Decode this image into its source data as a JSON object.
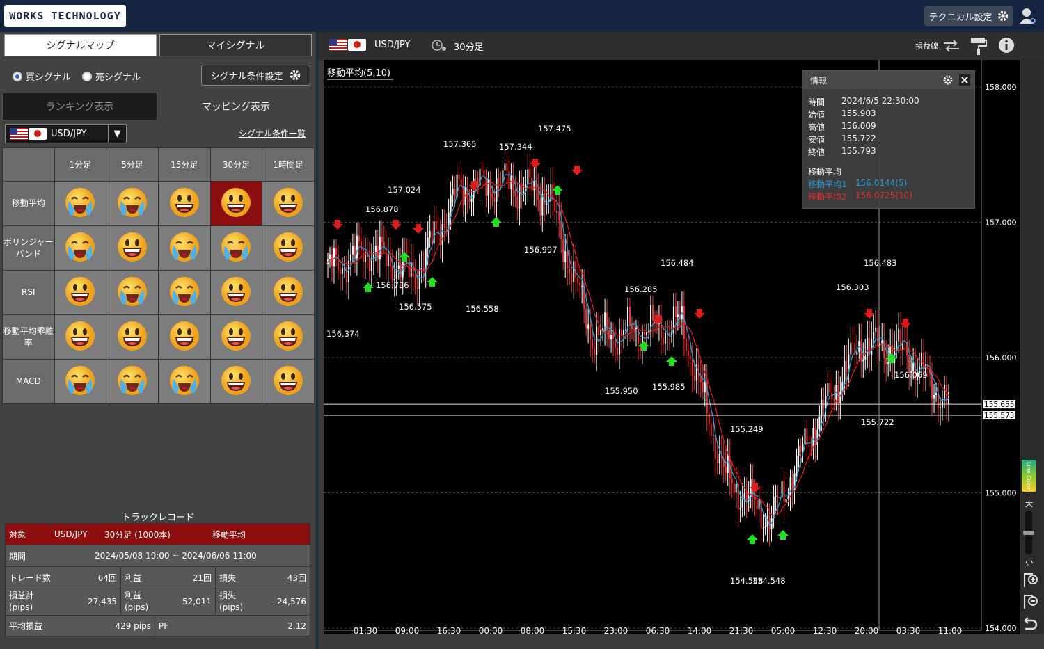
{
  "app": {
    "logo": "WORKS TECHNOLOGY",
    "tech_settings": "テクニカル設定"
  },
  "left": {
    "tabs": [
      "シグナルマップ",
      "マイシグナル"
    ],
    "radio_buy": "買シグナル",
    "radio_sell": "売シグナル",
    "cond_btn": "シグナル条件設定",
    "view_tabs": [
      "ランキング表示",
      "マッピング表示"
    ],
    "pair": "USD/JPY",
    "cond_list": "シグナル条件一覧",
    "timeframes": [
      "1分足",
      "5分足",
      "15分足",
      "30分足",
      "1時間足"
    ],
    "rows": [
      {
        "label": "移動平均",
        "cells": [
          "cry",
          "cry",
          "smile",
          "smile-sel",
          "smile"
        ]
      },
      {
        "label": "ボリンジャー バンド",
        "cells": [
          "cry",
          "smile",
          "cry",
          "cry",
          "smile"
        ]
      },
      {
        "label": "RSI",
        "cells": [
          "smile",
          "cry",
          "cry",
          "smile",
          "smile"
        ]
      },
      {
        "label": "移動平均乖離率",
        "cells": [
          "smile",
          "smile",
          "smile",
          "smile",
          "smile"
        ]
      },
      {
        "label": "MACD",
        "cells": [
          "cry",
          "cry",
          "cry",
          "smile",
          "smile"
        ]
      }
    ],
    "track": {
      "title": "トラックレコード",
      "target_k": "対象",
      "target_pair": "USD/JPY",
      "target_tf": "30分足 (1000本)",
      "target_ind": "移動平均",
      "period_k": "期間",
      "period_v": "2024/05/08 19:00 ~ 2024/06/06 11:00",
      "trades_k": "トレード数",
      "trades_v": "64回",
      "win_k": "利益",
      "win_v": "21回",
      "loss_k": "損失",
      "loss_v": "43回",
      "pl_k": "損益計\n(pips)",
      "pl_v": "27,435",
      "profit_k": "利益\n(pips)",
      "profit_v": "52,011",
      "lossp_k": "損失\n(pips)",
      "lossp_v": "- 24,576",
      "avg_k": "平均損益",
      "avg_v": "429 pips",
      "pf_k": "PF",
      "pf_v": "2.12"
    }
  },
  "chart": {
    "pair": "USD/JPY",
    "timeframe": "30分足",
    "pl_line": "損益線",
    "indicator_label": "移動平均(5,10)",
    "info": {
      "title": "情報",
      "time_k": "時間",
      "time_v": "2024/6/5 22:30:00",
      "open_k": "始値",
      "open_v": "155.903",
      "high_k": "高値",
      "high_v": "156.009",
      "low_k": "安値",
      "low_v": "155.722",
      "close_k": "終値",
      "close_v": "155.793",
      "ma_title": "移動平均",
      "ma1_k": "移動平均1",
      "ma1_v": "156.0144(5)",
      "ma2_k": "移動平均2",
      "ma2_v": "156.0725(10)"
    },
    "y_labels": [
      "158.000",
      "157.000",
      "156.000",
      "155.000",
      "154.000"
    ],
    "x_labels": [
      "01:30",
      "09:00",
      "16:30",
      "00:00",
      "08:00",
      "15:30",
      "23:00",
      "06:30",
      "14:00",
      "21:30",
      "05:00",
      "12:30",
      "20:00",
      "03:30",
      "11:00"
    ],
    "price_tags": [
      "155.655",
      "155.573"
    ],
    "sidebar": {
      "color_label": "Line Color",
      "big": "大",
      "small": "小"
    },
    "annotations": [
      "156.374",
      "156.878",
      "156.736",
      "157.024",
      "156.575",
      "157.365",
      "156.558",
      "157.344",
      "157.475",
      "156.997",
      "156.484",
      "156.285",
      "155.950",
      "155.985",
      "155.249",
      "154.548",
      "154.548",
      "156.303",
      "156.483",
      "155.722",
      "156.069"
    ],
    "colors": {
      "ma1": "#29a3e0",
      "ma2": "#e01c1c",
      "buy": "#22e022",
      "sell": "#e01c1c",
      "bull": "#ffffff",
      "bear": "#e33"
    }
  },
  "chart_data": {
    "type": "line",
    "title": "移動平均(5,10)",
    "x": [
      "01:30",
      "09:00",
      "16:30",
      "00:00",
      "08:00",
      "15:30",
      "23:00",
      "06:30",
      "14:00",
      "21:30",
      "05:00",
      "12:30",
      "20:00",
      "03:30",
      "11:00"
    ],
    "series": [
      {
        "name": "USD/JPY",
        "values": [
          156.65,
          156.8,
          156.6,
          157.25,
          157.3,
          157.2,
          156.15,
          156.2,
          156.25,
          155.1,
          154.8,
          155.5,
          156.1,
          156.05,
          155.65
        ]
      }
    ],
    "ylim": [
      154.0,
      158.2
    ]
  }
}
